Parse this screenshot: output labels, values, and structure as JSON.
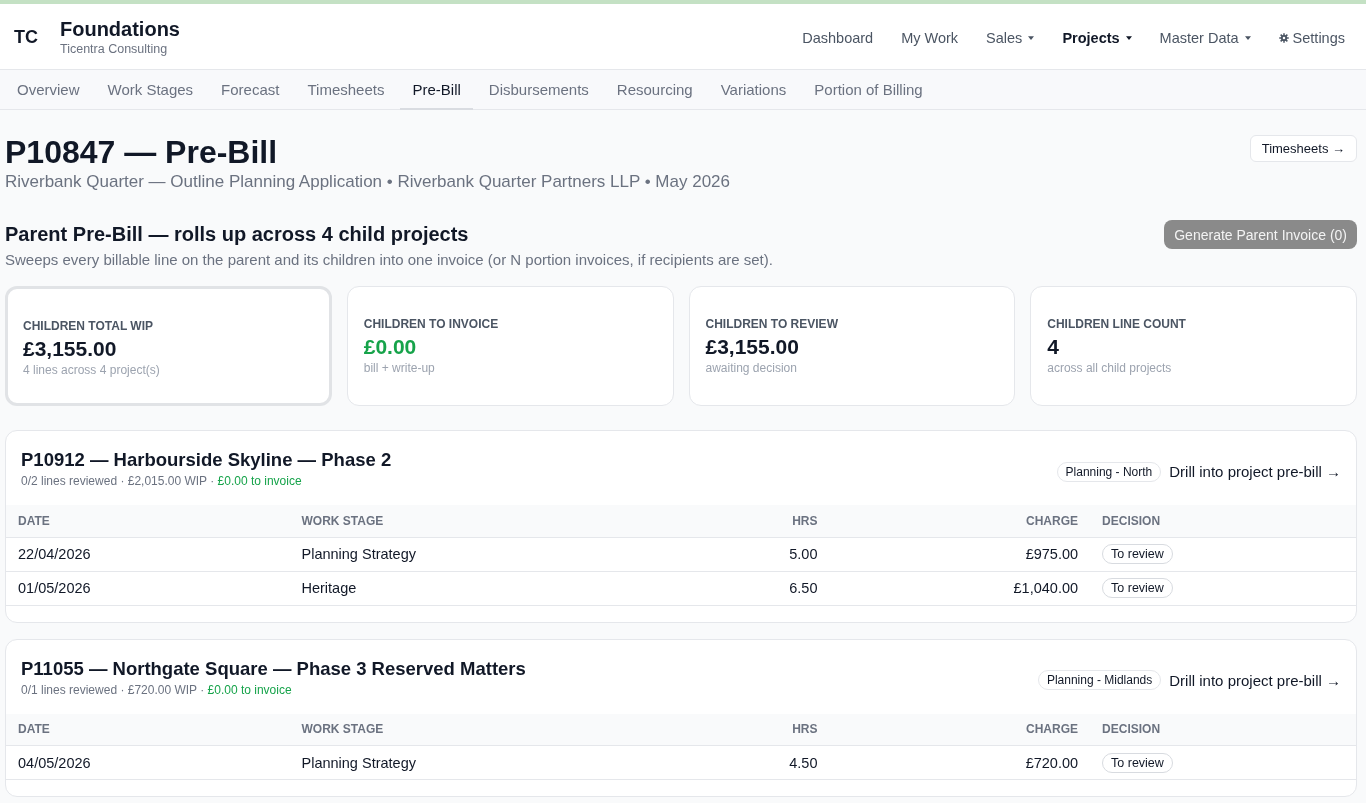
{
  "app": {
    "logo": "TC",
    "title": "Foundations",
    "subtitle": "Ticentra Consulting"
  },
  "nav": [
    {
      "label": "Dashboard",
      "kind": "link",
      "selected": false
    },
    {
      "label": "My Work",
      "kind": "link",
      "selected": false
    },
    {
      "label": "Sales",
      "kind": "menu",
      "selected": false
    },
    {
      "label": "Projects",
      "kind": "menu",
      "selected": true
    },
    {
      "label": "Master Data",
      "kind": "menu",
      "selected": false
    },
    {
      "label": "Settings",
      "kind": "settings",
      "selected": false
    }
  ],
  "tabs": [
    {
      "label": "Overview",
      "selected": false
    },
    {
      "label": "Work Stages",
      "selected": false
    },
    {
      "label": "Forecast",
      "selected": false
    },
    {
      "label": "Timesheets",
      "selected": false
    },
    {
      "label": "Pre-Bill",
      "selected": true
    },
    {
      "label": "Disbursements",
      "selected": false
    },
    {
      "label": "Resourcing",
      "selected": false
    },
    {
      "label": "Variations",
      "selected": false
    },
    {
      "label": "Portion of Billing",
      "selected": false
    }
  ],
  "page": {
    "title": "P10847 — Pre-Bill",
    "subtitle": "Riverbank Quarter — Outline Planning Application • Riverbank Quarter Partners LLP • May 2026",
    "action": "Timesheets →"
  },
  "parent": {
    "title": "Parent Pre-Bill — rolls up across 4 child projects",
    "description": "Sweeps every billable line on the parent and its children into one invoice (or N portion invoices, if recipients are set).",
    "button": {
      "label": "Generate Parent Invoice (0)",
      "disabled": true
    }
  },
  "stat_cards": [
    {
      "label": "CHILDREN TOTAL WIP",
      "value": "£3,155.00",
      "note": "4 lines across 4 project(s)",
      "color": "#111827",
      "highlighted": true
    },
    {
      "label": "CHILDREN TO INVOICE",
      "value": "£0.00",
      "note": "bill + write-up",
      "color": "#16a34a",
      "highlighted": false
    },
    {
      "label": "CHILDREN TO REVIEW",
      "value": "£3,155.00",
      "note": "awaiting decision",
      "color": "#111827",
      "highlighted": false
    },
    {
      "label": "CHILDREN LINE COUNT",
      "value": "4",
      "note": "across all child projects",
      "color": "#111827",
      "highlighted": false
    }
  ],
  "projects": [
    {
      "title": "P10912 — Harbourside Skyline — Phase 2",
      "meta": "0/2 lines reviewed · £2,015.00 WIP ·",
      "to_invoice": "£0.00 to invoice",
      "tag": "Planning - North",
      "link": "Drill into project pre-bill →",
      "table": {
        "columns": [
          {
            "label": "DATE",
            "kind": "text"
          },
          {
            "label": "WORK STAGE",
            "kind": "text"
          },
          {
            "label": "HRS",
            "kind": "number"
          },
          {
            "label": "CHARGE",
            "kind": "number"
          },
          {
            "label": "DECISION",
            "kind": "badge"
          }
        ],
        "rows": [
          {
            "cells": [
              "22/04/2026",
              "Planning Strategy",
              "5.00",
              "£975.00",
              "To review"
            ]
          },
          {
            "cells": [
              "01/05/2026",
              "Heritage",
              "6.50",
              "£1,040.00",
              "To review"
            ]
          }
        ]
      }
    },
    {
      "title": "P11055 — Northgate Square — Phase 3 Reserved Matters",
      "meta": "0/1 lines reviewed · £720.00 WIP ·",
      "to_invoice": "£0.00 to invoice",
      "tag": "Planning - Midlands",
      "link": "Drill into project pre-bill →",
      "table": {
        "columns": [
          {
            "label": "DATE",
            "kind": "text"
          },
          {
            "label": "WORK STAGE",
            "kind": "text"
          },
          {
            "label": "HRS",
            "kind": "number"
          },
          {
            "label": "CHARGE",
            "kind": "number"
          },
          {
            "label": "DECISION",
            "kind": "badge"
          }
        ],
        "rows": [
          {
            "cells": [
              "04/05/2026",
              "Planning Strategy",
              "4.50",
              "£720.00",
              "To review"
            ]
          }
        ]
      }
    }
  ]
}
